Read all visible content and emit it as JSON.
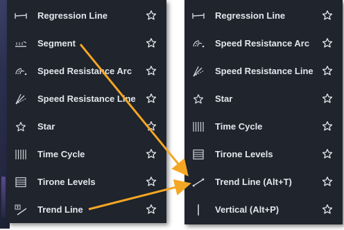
{
  "left_menu": {
    "items": [
      {
        "label": "Regression Line",
        "icon": "regression-line-icon"
      },
      {
        "label": "Segment",
        "icon": "segment-icon"
      },
      {
        "label": "Speed Resistance Arc",
        "icon": "speed-resistance-arc-icon"
      },
      {
        "label": "Speed Resistance Line",
        "icon": "speed-resistance-line-icon"
      },
      {
        "label": "Star",
        "icon": "star-icon"
      },
      {
        "label": "Time Cycle",
        "icon": "time-cycle-icon"
      },
      {
        "label": "Tirone Levels",
        "icon": "tirone-levels-icon"
      },
      {
        "label": "Trend Line",
        "icon": "trend-line-icon"
      }
    ]
  },
  "right_menu": {
    "items": [
      {
        "label": "Regression Line",
        "icon": "regression-line-icon"
      },
      {
        "label": "Speed Resistance Arc",
        "icon": "speed-resistance-arc-icon"
      },
      {
        "label": "Speed Resistance Line",
        "icon": "speed-resistance-line-icon"
      },
      {
        "label": "Star",
        "icon": "star-icon"
      },
      {
        "label": "Time Cycle",
        "icon": "time-cycle-icon"
      },
      {
        "label": "Tirone Levels",
        "icon": "tirone-levels-icon"
      },
      {
        "label": "Trend Line (Alt+T)",
        "icon": "trend-line-icon"
      },
      {
        "label": "Vertical (Alt+P)",
        "icon": "vertical-line-icon"
      }
    ]
  },
  "colors": {
    "panel_bg": "#1f242d",
    "text": "#e3e6eb",
    "icon": "#d0d4da",
    "arrow": "#f5a623"
  },
  "favorite_icon": "star-outline-icon"
}
